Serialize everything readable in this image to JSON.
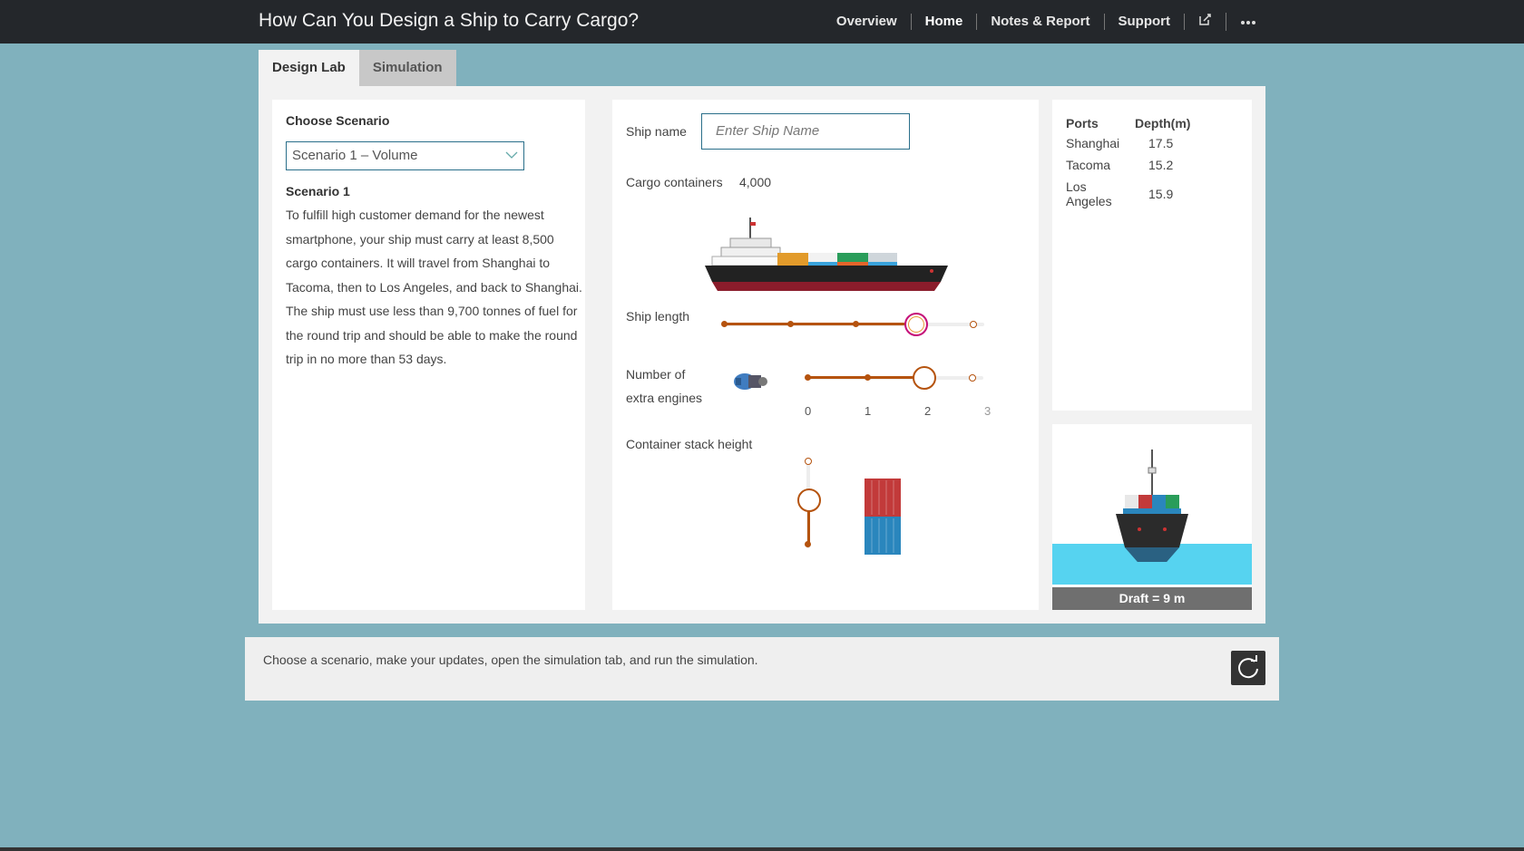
{
  "app": {
    "title": "How Can You Design a Ship to Carry Cargo?"
  },
  "nav": {
    "items": [
      "Overview",
      "Home",
      "Notes & Report",
      "Support"
    ],
    "active": "Home",
    "icons": [
      "edit-icon",
      "more-icon"
    ]
  },
  "tabs": [
    {
      "label": "Design Lab",
      "active": true
    },
    {
      "label": "Simulation",
      "active": false
    }
  ],
  "scenario": {
    "heading": "Choose Scenario",
    "selected": "Scenario 1 – Volume",
    "title": "Scenario 1",
    "description": "To fulfill high customer demand for the newest smartphone, your ship must carry at least 8,500 cargo containers. It will travel from Shanghai to Tacoma, then to Los Angeles, and back to Shanghai. The ship must use less than 9,700 tonnes of fuel for the round trip and should be able to make the round trip in no more than 53 days."
  },
  "design": {
    "ship_name_label": "Ship name",
    "ship_name_placeholder": "Enter Ship Name",
    "cargo_label": "Cargo containers",
    "cargo_value": "4,000",
    "ship_length_label": "Ship length",
    "ship_length_level": 3,
    "ship_length_steps": 5,
    "engines_label_1": "Number of",
    "engines_label_2": "extra engines",
    "engines_ticks": [
      "0",
      "1",
      "2",
      "3"
    ],
    "engines_value": 2,
    "stack_label": "Container stack height",
    "stack_level": 1,
    "stack_steps": 3
  },
  "ports": {
    "headers": [
      "Ports",
      "Depth(m)"
    ],
    "rows": [
      {
        "name": "Shanghai",
        "depth": "17.5"
      },
      {
        "name": "Tacoma",
        "depth": "15.2"
      },
      {
        "name": "Los Angeles",
        "depth": "15.9"
      }
    ]
  },
  "draft": {
    "label": "Draft = 9 m"
  },
  "footer": {
    "message": "Choose a scenario, make your updates, open the simulation tab, and run the simulation."
  },
  "colors": {
    "background": "#80b1bd",
    "topbar": "#24272b",
    "accent": "#b5530e",
    "water": "#56d3f0"
  }
}
